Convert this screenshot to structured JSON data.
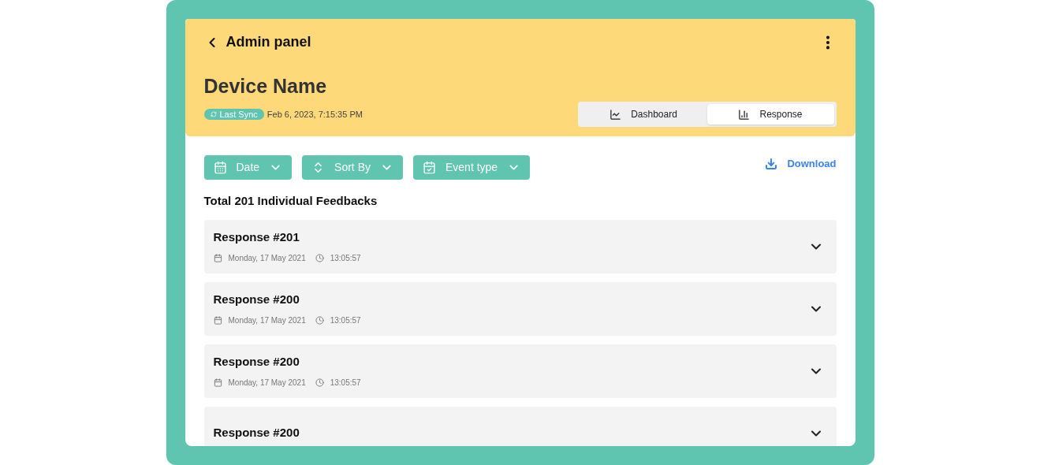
{
  "header": {
    "back_title": "Admin panel",
    "device_name": "Device Name",
    "sync_badge": "Last Sync",
    "sync_time": "Feb 6, 2023, 7:15:35 PM"
  },
  "tabs": [
    {
      "kind": "line",
      "label": "Dashboard",
      "selected": false
    },
    {
      "kind": "bars",
      "label": "Response",
      "selected": true
    }
  ],
  "filters": [
    {
      "kind": "calendar",
      "label": "Date"
    },
    {
      "kind": "sort",
      "label": "Sort By"
    },
    {
      "kind": "event",
      "label": "Event type"
    }
  ],
  "download": "Download",
  "total": "Total 201 Individual Feedbacks",
  "responses": [
    {
      "title": "Response #201",
      "date": "Monday, 17 May 2021",
      "time": "13:05:57"
    },
    {
      "title": "Response #200",
      "date": "Monday, 17 May 2021",
      "time": "13:05:57"
    },
    {
      "title": "Response #200",
      "date": "Monday, 17 May 2021",
      "time": "13:05:57"
    },
    {
      "title": "Response #200"
    }
  ]
}
